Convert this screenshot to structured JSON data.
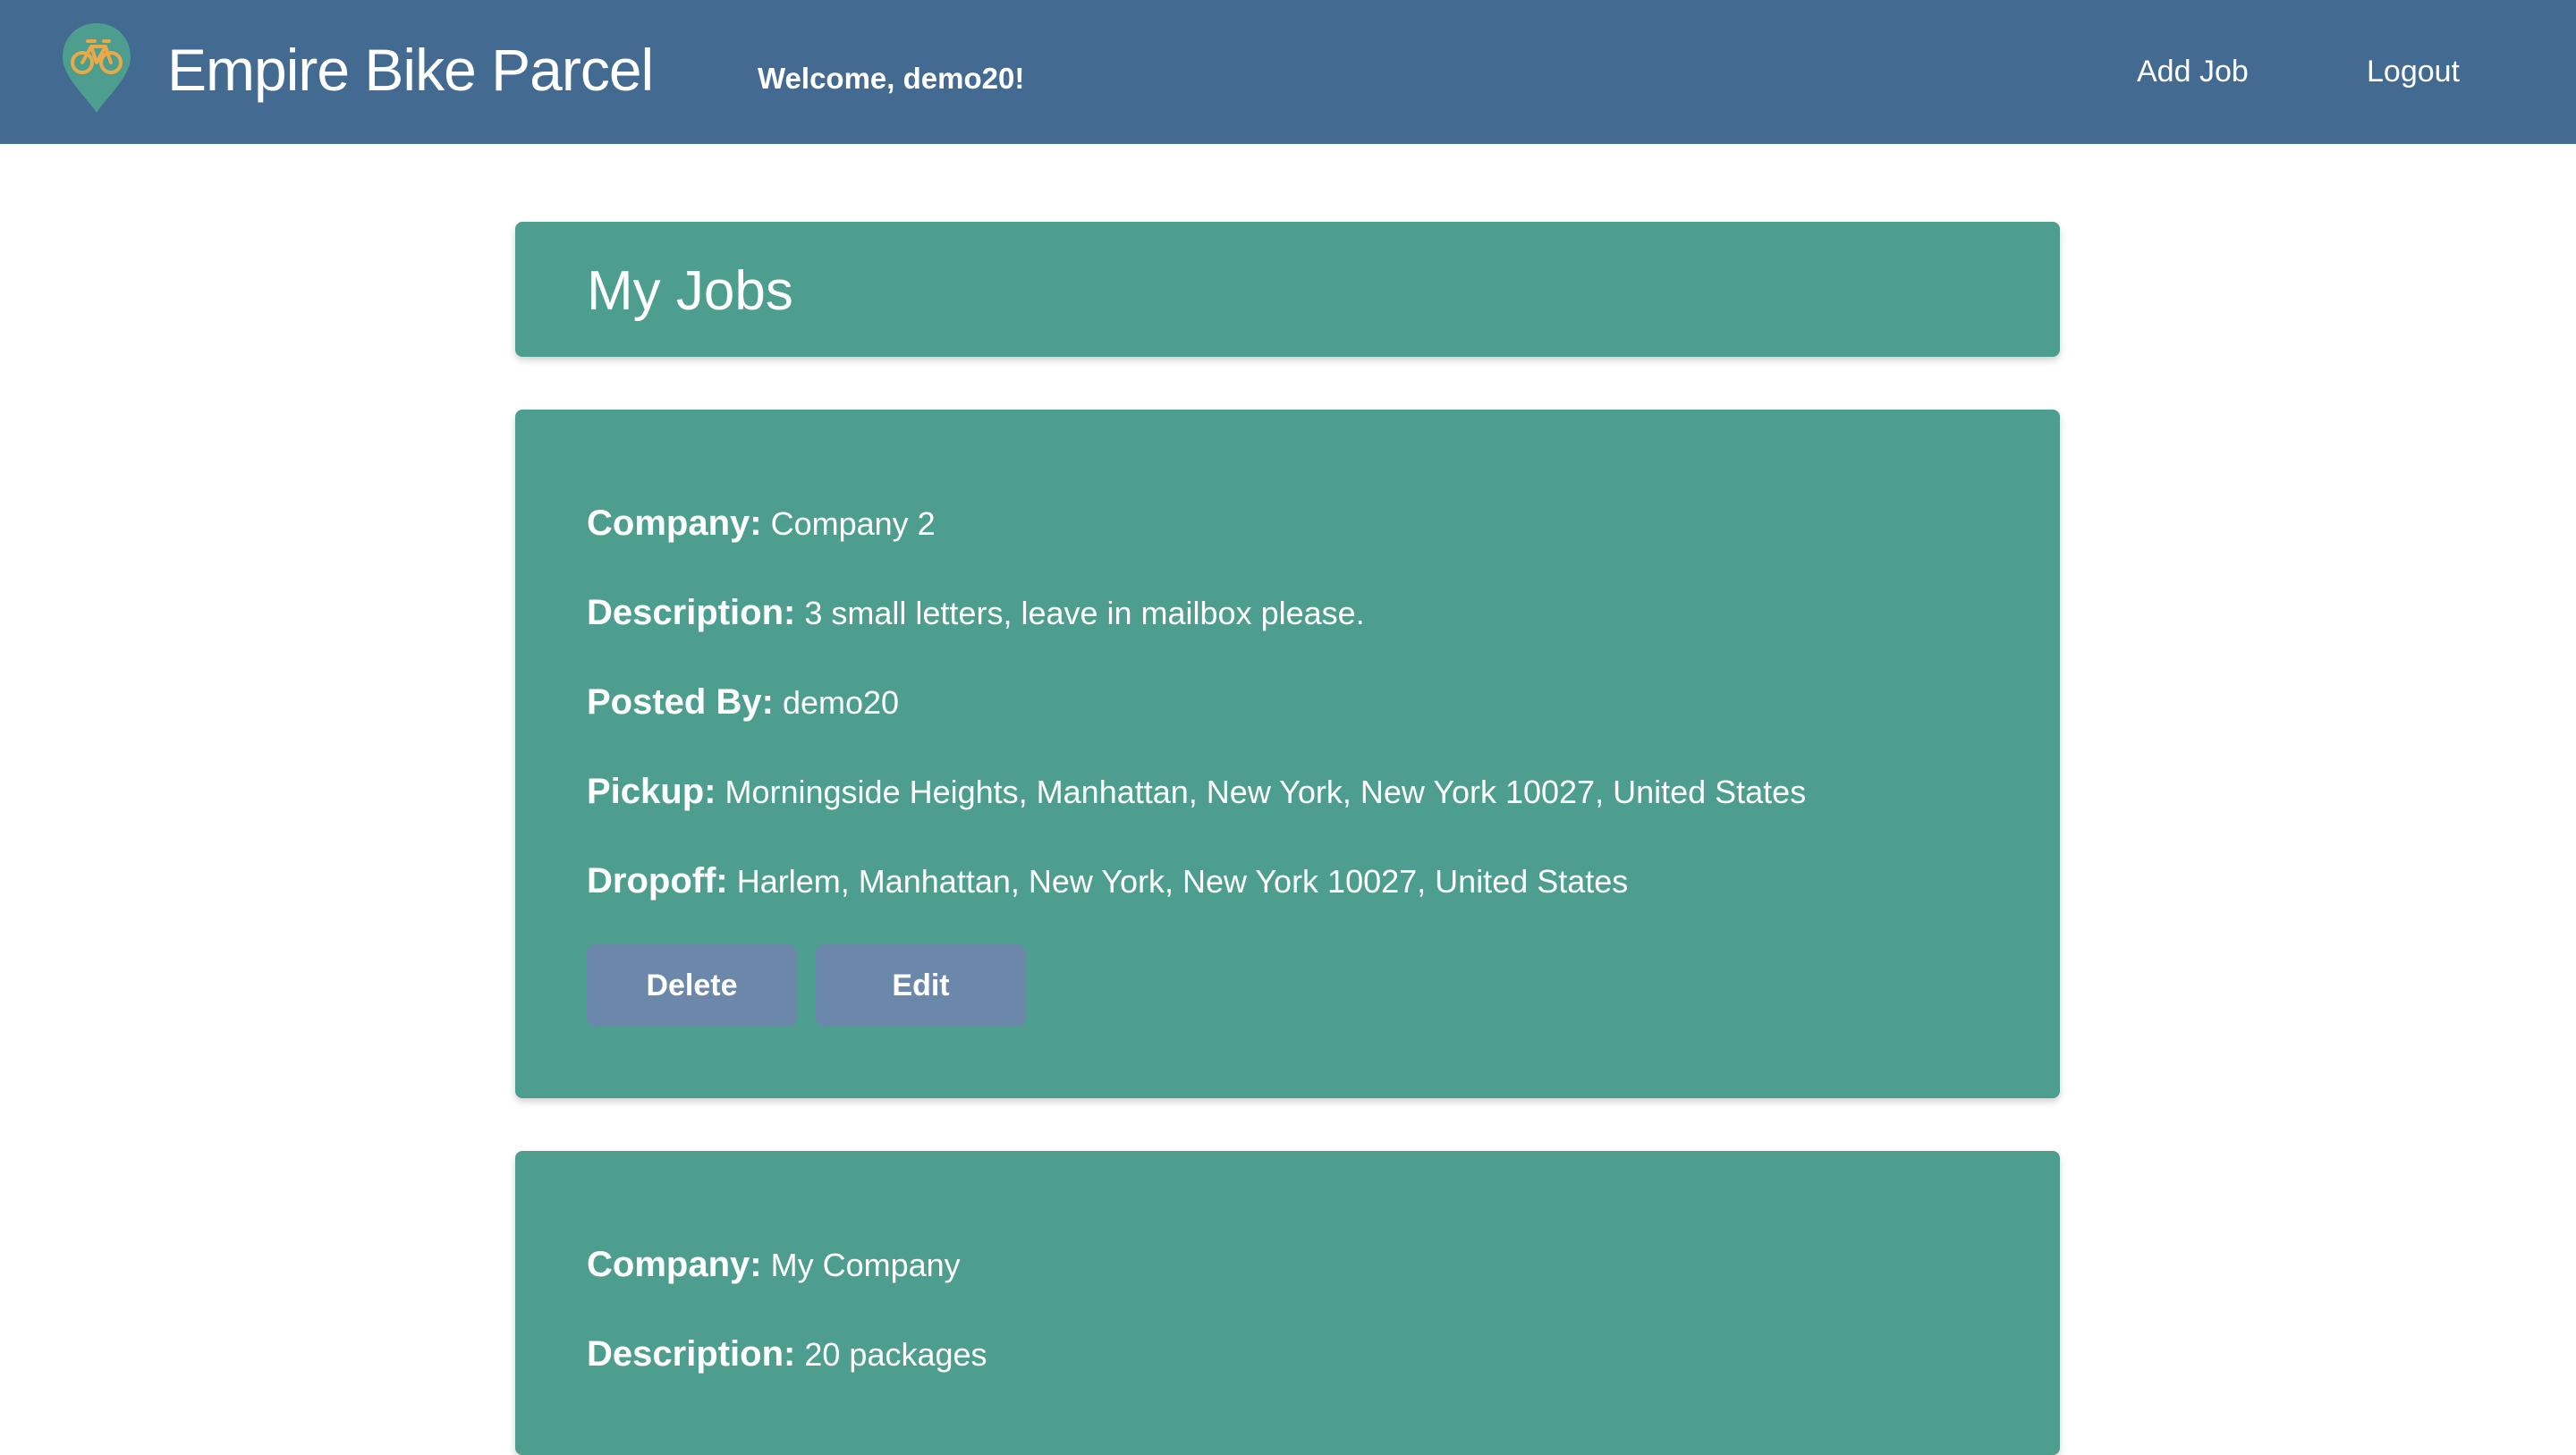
{
  "navbar": {
    "brand": "Empire Bike Parcel",
    "welcome": "Welcome, demo20!",
    "links": {
      "add_job": "Add Job",
      "logout": "Logout"
    },
    "logo_icon": "bike-map-pin-icon",
    "colors": {
      "bar": "#436a90",
      "pin": "#4e9e8f",
      "bike": "#e8a94a"
    }
  },
  "page": {
    "title": "My Jobs"
  },
  "jobs": [
    {
      "company_label": "Company:",
      "company": "Company 2",
      "description_label": "Description:",
      "description": "3 small letters, leave in mailbox please.",
      "posted_by_label": "Posted By:",
      "posted_by": "demo20",
      "pickup_label": "Pickup:",
      "pickup": "Morningside Heights, Manhattan, New York, New York 10027, United States",
      "dropoff_label": "Dropoff:",
      "dropoff": "Harlem, Manhattan, New York, New York 10027, United States",
      "delete_label": "Delete",
      "edit_label": "Edit"
    },
    {
      "company_label": "Company:",
      "company": "My Company",
      "description_label": "Description:",
      "description": "20 packages"
    }
  ],
  "colors": {
    "card": "#4e9e8f",
    "button": "#6b87a9"
  }
}
